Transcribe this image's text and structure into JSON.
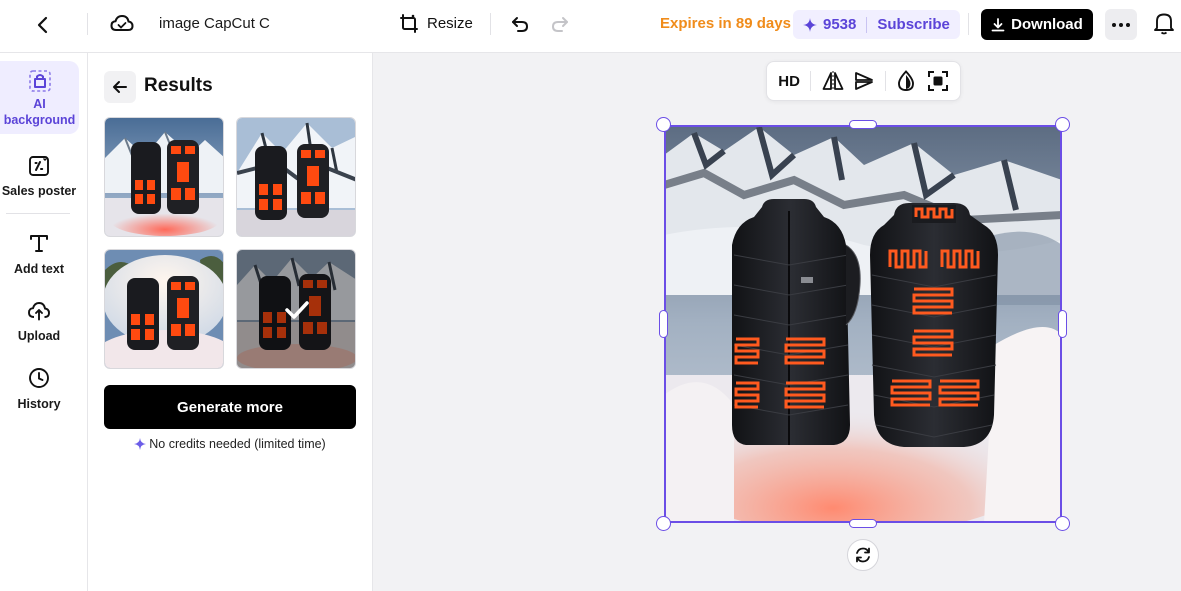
{
  "topbar": {
    "title": "image CapCut C",
    "resize_label": "Resize",
    "expires_label": "Expires in 89 days",
    "credits_count": "9538",
    "subscribe_label": "Subscribe",
    "download_label": "Download"
  },
  "rail": {
    "items": [
      {
        "label": "AI background",
        "icon": "ai-background-icon",
        "active": true
      },
      {
        "label": "Sales poster",
        "icon": "sales-poster-icon",
        "active": false
      },
      {
        "label": "Add text",
        "icon": "text-icon",
        "active": false
      },
      {
        "label": "Upload",
        "icon": "upload-cloud-icon",
        "active": false
      },
      {
        "label": "History",
        "icon": "clock-icon",
        "active": false
      }
    ]
  },
  "panel": {
    "title": "Results",
    "generate_label": "Generate more",
    "note": "No credits needed (limited time)",
    "results": [
      {
        "variant": "mountain-red-glow",
        "selected": false
      },
      {
        "variant": "snowy-slope",
        "selected": false
      },
      {
        "variant": "snow-drift",
        "selected": false
      },
      {
        "variant": "mountain-snow",
        "selected": true
      }
    ]
  },
  "canvas": {
    "toolbar": {
      "hd_label": "HD"
    }
  },
  "colors": {
    "accent": "#5b44d8",
    "expires": "#f08c1b",
    "selection": "#6b4ee6",
    "heater": "#ff5a1f"
  }
}
